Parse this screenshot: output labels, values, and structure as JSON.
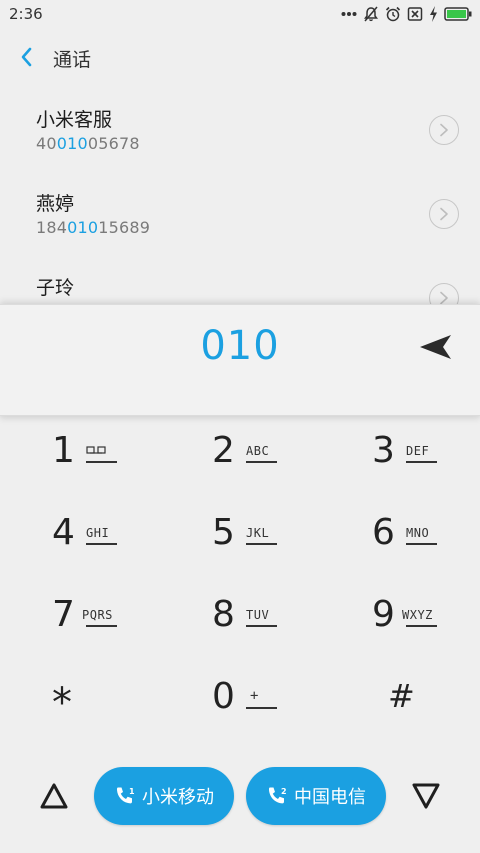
{
  "status_bar": {
    "time": "2:36",
    "icons": [
      "more-dots-icon",
      "mute-bell-icon",
      "alarm-icon",
      "no-sim-icon",
      "charging-icon",
      "battery-icon"
    ],
    "battery_color": "#39c64a"
  },
  "header": {
    "title": "通话",
    "back_icon": "chevron-left-icon"
  },
  "contacts": [
    {
      "name": "小米客服",
      "number_pre": "40",
      "number_match": "010",
      "number_post": "05678"
    },
    {
      "name": "燕婷",
      "number_pre": "184",
      "number_match": "010",
      "number_post": "15689"
    },
    {
      "name": "子玲",
      "number_pre": "",
      "number_match": "",
      "number_post": ""
    }
  ],
  "dialer": {
    "input": "010"
  },
  "keypad": {
    "keys": [
      {
        "digit": "1",
        "letters": ""
      },
      {
        "digit": "2",
        "letters": "ABC"
      },
      {
        "digit": "3",
        "letters": "DEF"
      },
      {
        "digit": "4",
        "letters": "GHI"
      },
      {
        "digit": "5",
        "letters": "JKL"
      },
      {
        "digit": "6",
        "letters": "MNO"
      },
      {
        "digit": "7",
        "letters": "PQRS"
      },
      {
        "digit": "8",
        "letters": "TUV"
      },
      {
        "digit": "9",
        "letters": "WXYZ"
      },
      {
        "digit": "*",
        "letters": ""
      },
      {
        "digit": "0",
        "letters": "+"
      },
      {
        "digit": "#",
        "letters": ""
      }
    ]
  },
  "bottom_bar": {
    "sim1_label": "小米移动",
    "sim2_label": "中国电信",
    "accent": "#1ba0e1"
  }
}
